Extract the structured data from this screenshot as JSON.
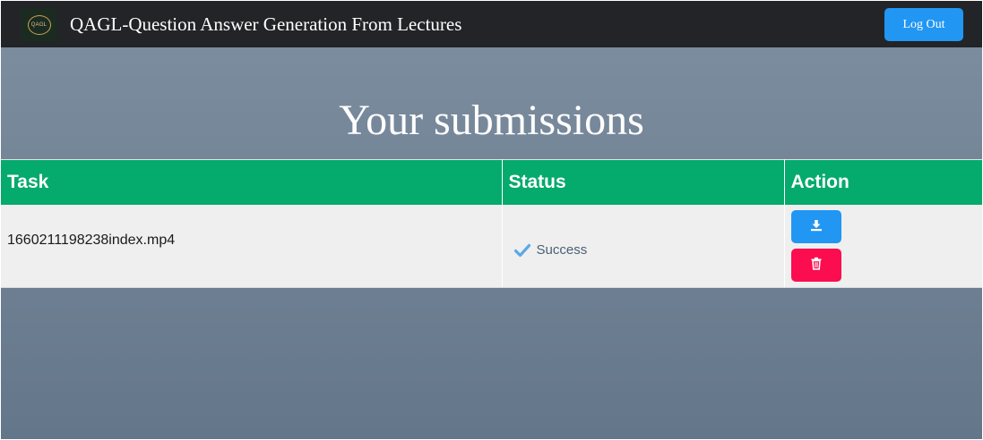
{
  "header": {
    "logo_text": "QAGL",
    "title": "QAGL-Question Answer Generation From Lectures",
    "logout_label": "Log Out"
  },
  "page": {
    "heading": "Your submissions"
  },
  "table": {
    "columns": [
      "Task",
      "Status",
      "Action"
    ],
    "rows": [
      {
        "task": "1660211198238index.mp4",
        "status": "Success",
        "status_icon": "check-icon",
        "actions": [
          {
            "name": "download",
            "icon": "download-icon"
          },
          {
            "name": "delete",
            "icon": "trash-icon"
          }
        ]
      }
    ]
  },
  "colors": {
    "navbar": "#222427",
    "header_row": "#05aa6d",
    "primary": "#2196f3",
    "danger": "#fc0d4f",
    "row_bg": "#efefef",
    "success_check": "#5aa9e6"
  }
}
